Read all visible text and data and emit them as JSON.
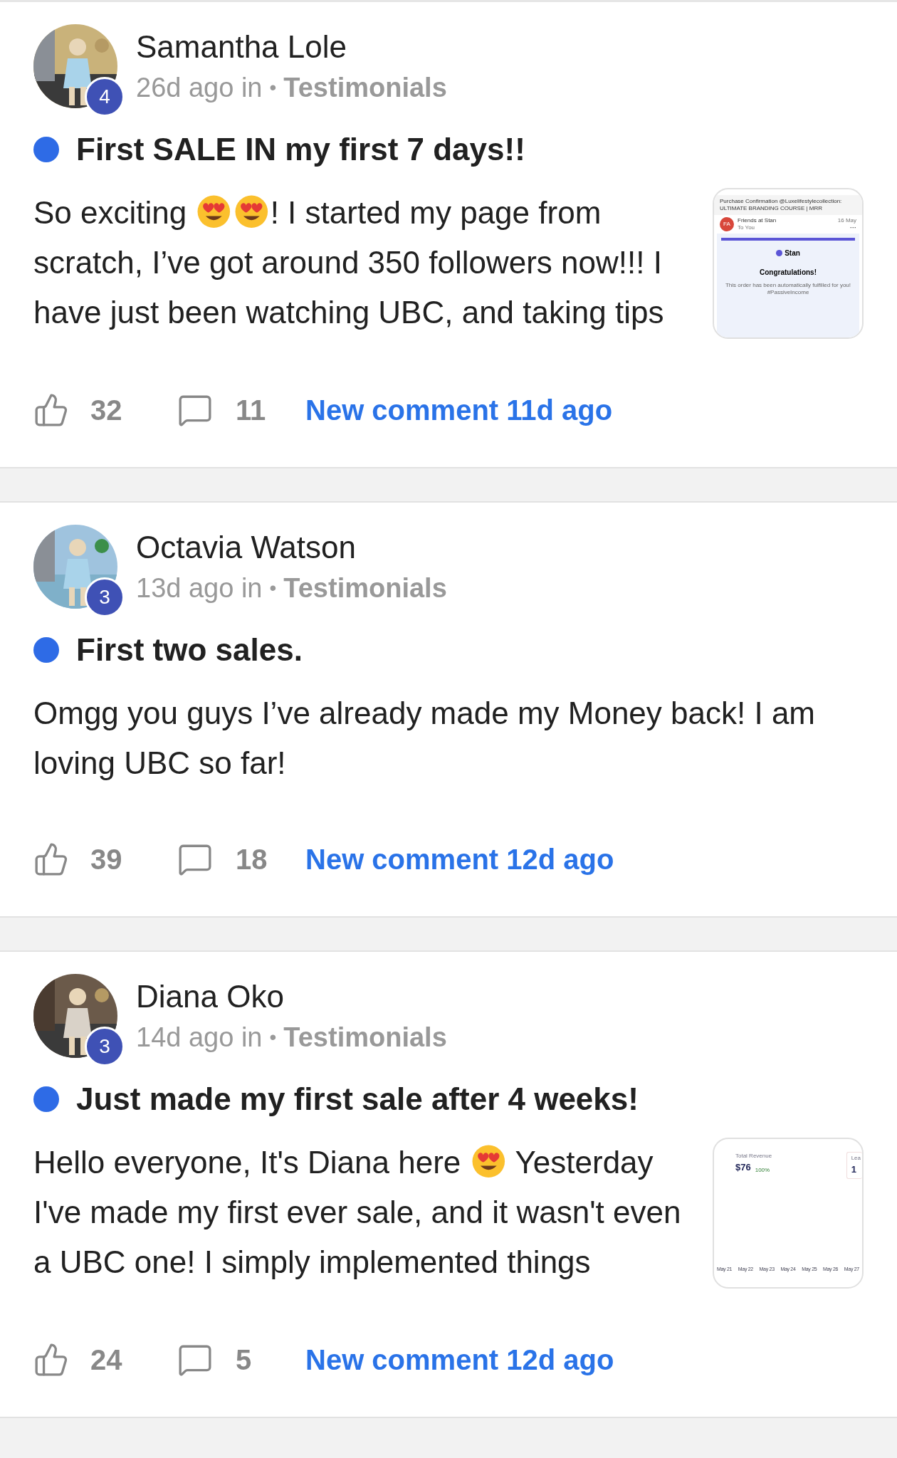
{
  "posts": [
    {
      "author": "Samantha Lole",
      "level": "4",
      "time": "26d ago in",
      "separator": "•",
      "category": "Testimonials",
      "unread": true,
      "title": "First SALE IN my first 7 days!!",
      "body": [
        {
          "kind": "text",
          "text": "So exciting "
        },
        {
          "kind": "emoji"
        },
        {
          "kind": "emoji"
        },
        {
          "kind": "text",
          "text": "! I started my page from scratch, I’ve got around 350 followers now!!! I have just been watching UBC, and taking tips"
        }
      ],
      "attachment": {
        "kind": "email",
        "subject": "Purchase Confirmation @Luxelifestylecollection: ULTIMATE BRANDING COURSE | MRR",
        "initials": "FA",
        "sender": "Friends at Stan",
        "recipient": "To You",
        "date": "16 May",
        "more": "···",
        "brand": "Stan",
        "heading": "Congratulations!",
        "message": "This order has been automatically fulfilled for you!",
        "tag": "#PassiveIncome"
      },
      "likes": "32",
      "comments": "11",
      "new_comment": "New comment 11d ago"
    },
    {
      "author": "Octavia Watson",
      "level": "3",
      "time": "13d ago in",
      "separator": "•",
      "category": "Testimonials",
      "unread": true,
      "title": "First two sales.",
      "body": [
        {
          "kind": "text",
          "text": "Omgg you guys I’ve already made my Money back! I am loving UBC so far!"
        }
      ],
      "likes": "39",
      "comments": "18",
      "new_comment": "New comment 12d ago"
    },
    {
      "author": "Diana Oko",
      "level": "3",
      "time": "14d ago in",
      "separator": "•",
      "category": "Testimonials",
      "unread": true,
      "title": "Just made my first sale after 4 weeks!",
      "body": [
        {
          "kind": "text",
          "text": "Hello everyone, It's Diana here "
        },
        {
          "kind": "emoji"
        },
        {
          "kind": "text",
          "text": " Yesterday I've made my first ever sale, and it wasn't even a UBC one! I simply implemented things"
        }
      ],
      "attachment": {
        "kind": "dashboard",
        "label": "Total Revenue",
        "value": "$76",
        "change": "100%",
        "second_label": "Lea",
        "second_value": "1",
        "dates": [
          "May 21",
          "May 22",
          "May 23",
          "May 24",
          "May 25",
          "May 26",
          "May 27"
        ]
      },
      "likes": "24",
      "comments": "5",
      "new_comment": "New comment 12d ago"
    }
  ]
}
